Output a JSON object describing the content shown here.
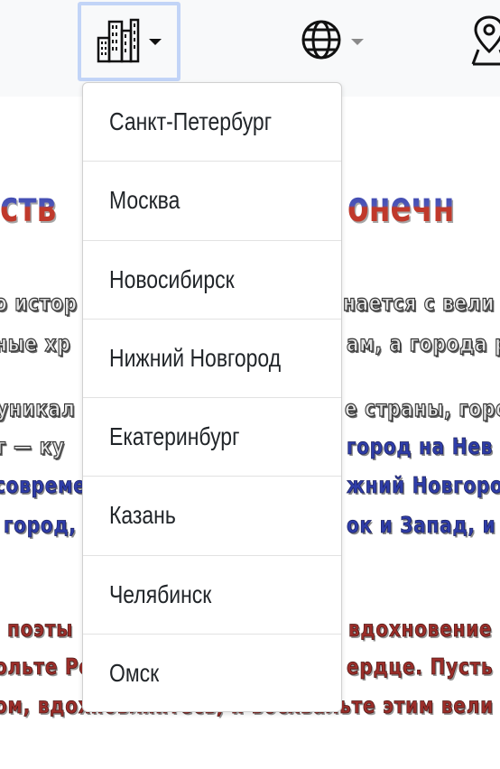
{
  "navbar": {
    "city_icon": "city-buildings-icon",
    "globe_icon": "globe-icon",
    "map_icon": "map-pin-icon"
  },
  "background_text": {
    "heading_left": "ств",
    "heading_right": "онечн",
    "lines": [
      {
        "left": "о истор",
        "right": "нается с вели"
      },
      {
        "left": "ные хр",
        "right": "ам, а города р"
      },
      {
        "left": "уникал",
        "right": "е страны, горо"
      },
      {
        "left": "г — ку",
        "right": "город на Нев"
      },
      {
        "left": "совреме",
        "right": "жний Новгоро"
      },
      {
        "left": "город,",
        "right": "ок и Запад, и"
      },
      {
        "left": "поэты",
        "right": "вдохновение"
      },
      {
        "left": "ольте Ро",
        "right": "ердце. Пусть"
      },
      {
        "left": "ом, вдохновляйтесь, и восхвальте этим вели",
        "right": ""
      }
    ]
  },
  "dropdown": {
    "items": [
      "Санкт-Петербург",
      "Москва",
      "Новосибирск",
      "Нижний Новгород",
      "Екатеринбург",
      "Казань",
      "Челябинск",
      "Омск"
    ]
  },
  "colors": {
    "accent_blue": "#2f3da8",
    "accent_red": "#c0392b",
    "focus_ring": "#c2d4f7"
  }
}
